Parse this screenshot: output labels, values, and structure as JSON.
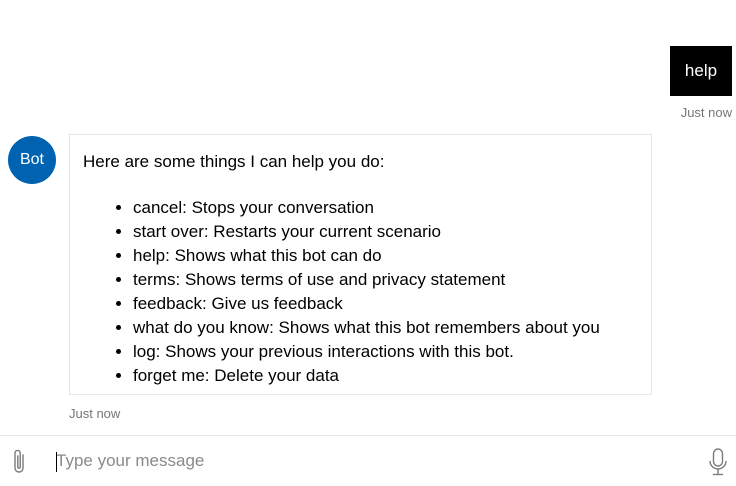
{
  "user_message": {
    "text": "help",
    "timestamp": "Just now"
  },
  "bot_message": {
    "avatar_initials": "Bot",
    "intro": "Here are some things I can help you do:",
    "items": [
      "cancel: Stops your conversation",
      "start over: Restarts your current scenario",
      "help: Shows what this bot can do",
      "terms: Shows terms of use and privacy statement",
      "feedback: Give us feedback",
      "what do you know: Shows what this bot remembers about you",
      "log: Shows your previous interactions with this bot.",
      "forget me: Delete your data"
    ],
    "timestamp": "Just now"
  },
  "input": {
    "placeholder": "Type your message",
    "value": ""
  },
  "icons": {
    "attach": "paperclip-icon",
    "mic": "microphone-icon"
  },
  "colors": {
    "avatar_bg": "#0063b1",
    "user_bubble_bg": "#000000",
    "timestamp": "#767676"
  }
}
